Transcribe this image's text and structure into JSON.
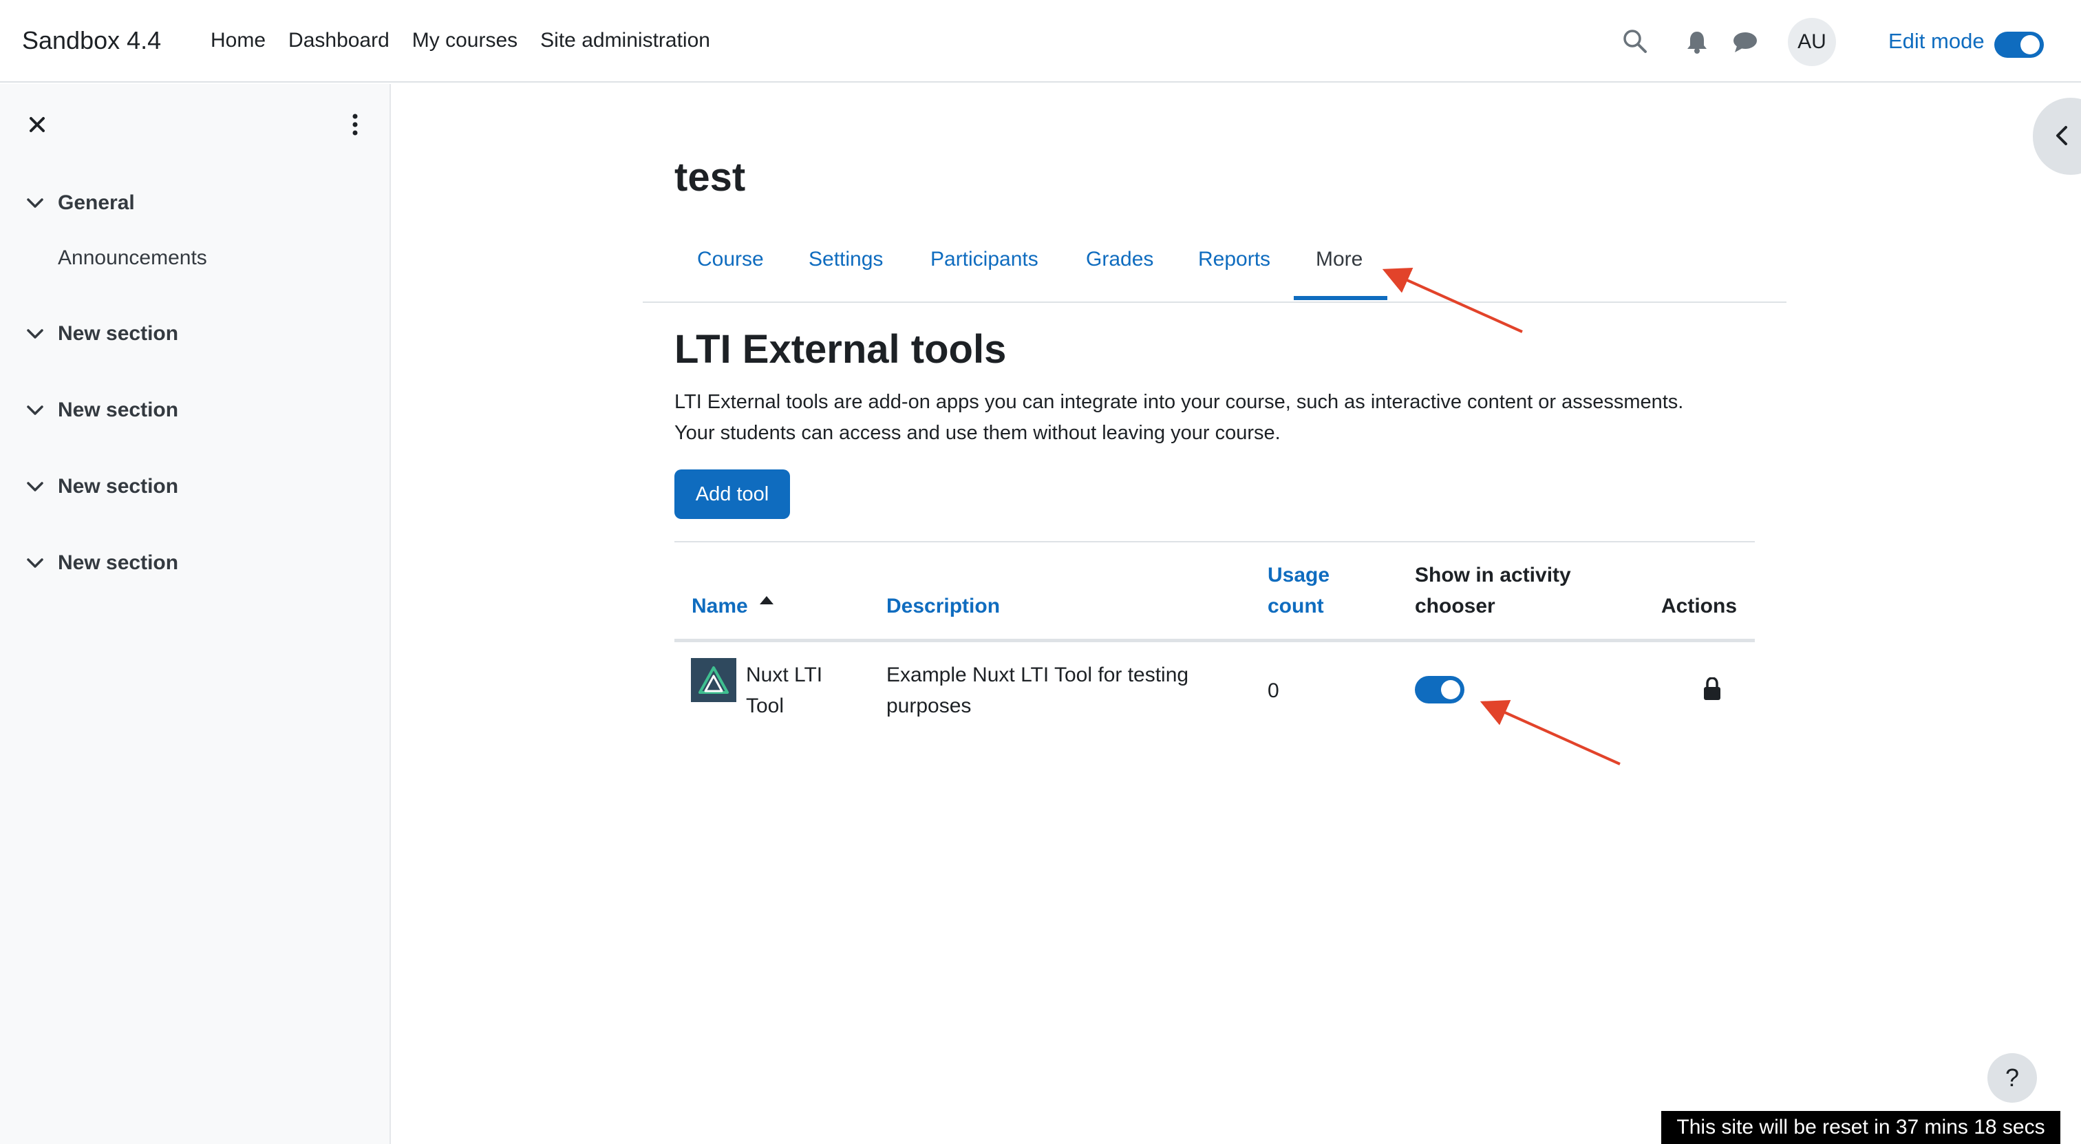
{
  "navbar": {
    "brand": "Sandbox 4.4",
    "links": [
      "Home",
      "Dashboard",
      "My courses",
      "Site administration"
    ],
    "avatar_initials": "AU",
    "edit_mode_label": "Edit mode",
    "edit_mode_on": true
  },
  "drawer": {
    "sections": [
      {
        "label": "General",
        "items": [
          "Announcements"
        ]
      },
      {
        "label": "New section",
        "items": []
      },
      {
        "label": "New section",
        "items": []
      },
      {
        "label": "New section",
        "items": []
      },
      {
        "label": "New section",
        "items": []
      }
    ]
  },
  "course": {
    "title": "test",
    "tabs": [
      "Course",
      "Settings",
      "Participants",
      "Grades",
      "Reports",
      "More"
    ],
    "active_tab": "More"
  },
  "tools_page": {
    "heading": "LTI External tools",
    "description_line1": "LTI External tools are add-on apps you can integrate into your course, such as interactive content or assessments.",
    "description_line2": "Your students can access and use them without leaving your course.",
    "add_button": "Add tool",
    "columns": {
      "name": "Name",
      "description": "Description",
      "usage_line1": "Usage",
      "usage_line2": "count",
      "show_line1": "Show in activity",
      "show_line2": "chooser",
      "actions": "Actions"
    },
    "rows": [
      {
        "name_line1": "Nuxt LTI",
        "name_line2": "Tool",
        "description_line1": "Example Nuxt LTI Tool for testing",
        "description_line2": "purposes",
        "usage_count": "0",
        "show_in_chooser": true
      }
    ]
  },
  "footer": {
    "help": "?",
    "reset_notice": "This site will be reset in 37 mins 18 secs"
  },
  "colors": {
    "primary": "#0f6cbf",
    "annotation_arrow": "#e2432a",
    "tool_icon_bg": "#2f495e"
  }
}
